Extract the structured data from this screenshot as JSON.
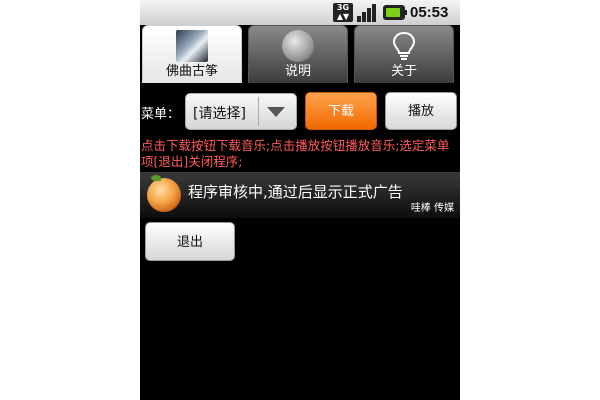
{
  "status_bar": {
    "network": "3G",
    "time": "05:53"
  },
  "tabs": [
    {
      "label": "佛曲古筝",
      "icon": "album-art-icon",
      "active": true
    },
    {
      "label": "说明",
      "icon": "egg-icon",
      "active": false
    },
    {
      "label": "关于",
      "icon": "lightbulb-icon",
      "active": false
    }
  ],
  "menu": {
    "label": "菜单：",
    "selected": "[请选择]"
  },
  "buttons": {
    "download": "下载",
    "play": "播放",
    "exit": "退出"
  },
  "instructions": "点击下载按钮下载音乐;点击播放按钮播放音乐;选定菜单项[退出]关闭程序;",
  "ad": {
    "text": "程序审核中,通过后显示正式广告",
    "brand": "哇棒 传媒"
  },
  "colors": {
    "accent": "#f27a10",
    "instruction_text": "#ff5b5b",
    "background": "#000000"
  }
}
